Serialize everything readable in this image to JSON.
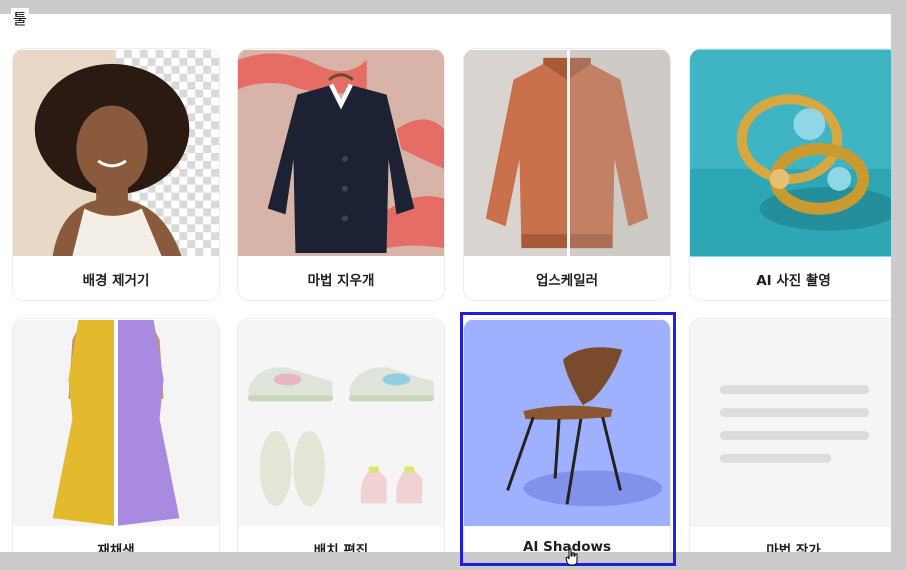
{
  "section": {
    "title": "툴"
  },
  "tools": [
    {
      "label": "배경 제거기"
    },
    {
      "label": "마법 지우개"
    },
    {
      "label": "업스케일러"
    },
    {
      "label": "AI 사진 촬영"
    },
    {
      "label": "재채색"
    },
    {
      "label": "배치 편집"
    },
    {
      "label": "AI Shadows"
    },
    {
      "label": "마법 작가"
    }
  ],
  "colors": {
    "selection_border": "#1f1fe0",
    "shadows_bg": "#9fb0ff",
    "window_bg": "#cbcbcb"
  }
}
